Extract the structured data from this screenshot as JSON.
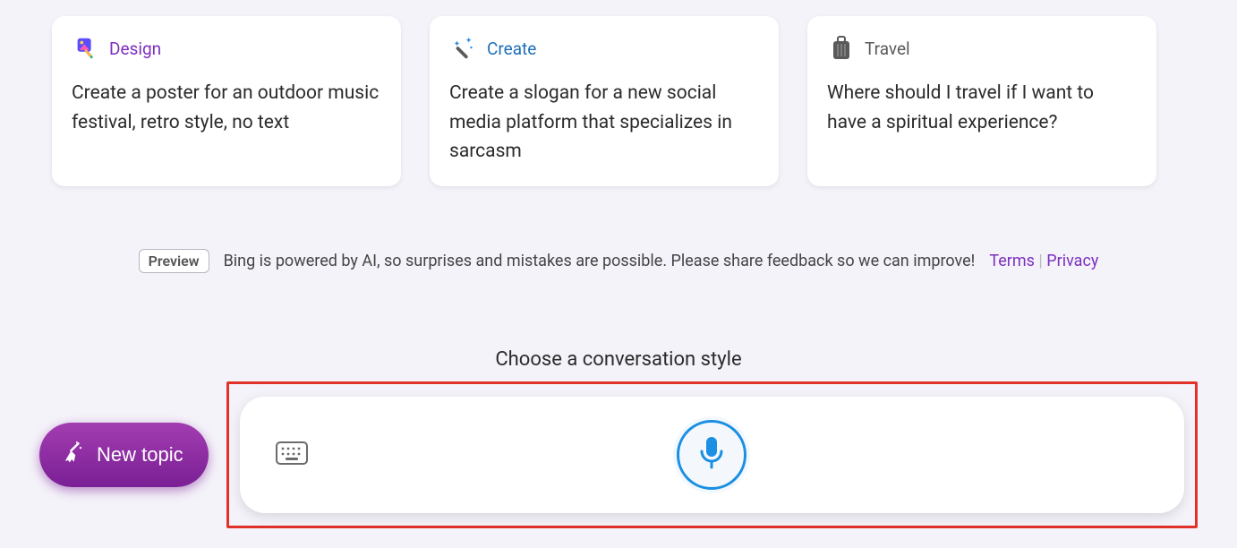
{
  "cards": [
    {
      "title": "Design",
      "body": "Create a poster for an outdoor music festival, retro style, no text"
    },
    {
      "title": "Create",
      "body": "Create a slogan for a new social media platform that specializes in sarcasm"
    },
    {
      "title": "Travel",
      "body": "Where should I travel if I want to have a spiritual experience?"
    }
  ],
  "disclaimer": {
    "badge": "Preview",
    "text": "Bing is powered by AI, so surprises and mistakes are possible. Please share feedback so we can improve!",
    "terms": "Terms",
    "privacy": "Privacy"
  },
  "style_heading": "Choose a conversation style",
  "new_topic": "New topic"
}
